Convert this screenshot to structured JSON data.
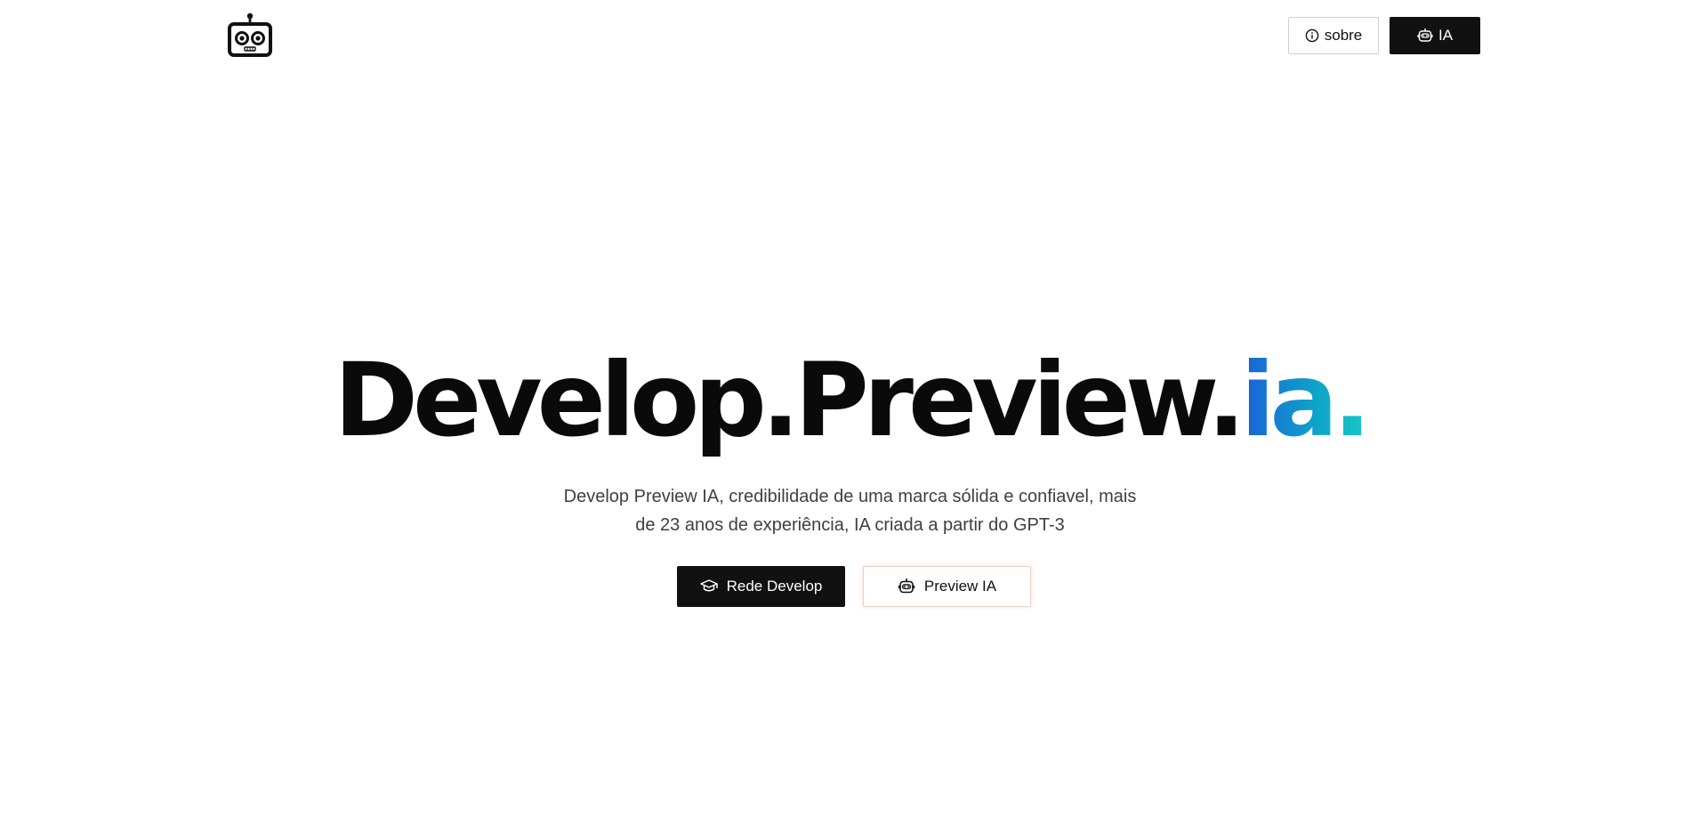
{
  "header": {
    "logo_icon": "robot-logo-icon",
    "nav": {
      "about_label": "sobre",
      "about_icon": "info-icon",
      "ia_label": "IA",
      "ia_icon": "robot-icon"
    }
  },
  "hero": {
    "title_main": "Develop.Preview.",
    "title_accent": "ia.",
    "subtitle_line1": "Develop Preview IA, credibilidade de uma marca sólida e confiavel, mais",
    "subtitle_line2": "de 23 anos de experiência, IA criada a partir do GPT-3",
    "buttons": {
      "rede_label": "Rede Develop",
      "rede_icon": "graduation-cap-icon",
      "preview_label": "Preview IA",
      "preview_icon": "robot-icon"
    }
  },
  "colors": {
    "background": "#ffffff",
    "primary_dark": "#111111",
    "accent_gradient_start": "#1a5fd6",
    "accent_gradient_end": "#19c6c6",
    "subtitle_text": "#3f3f3f"
  }
}
